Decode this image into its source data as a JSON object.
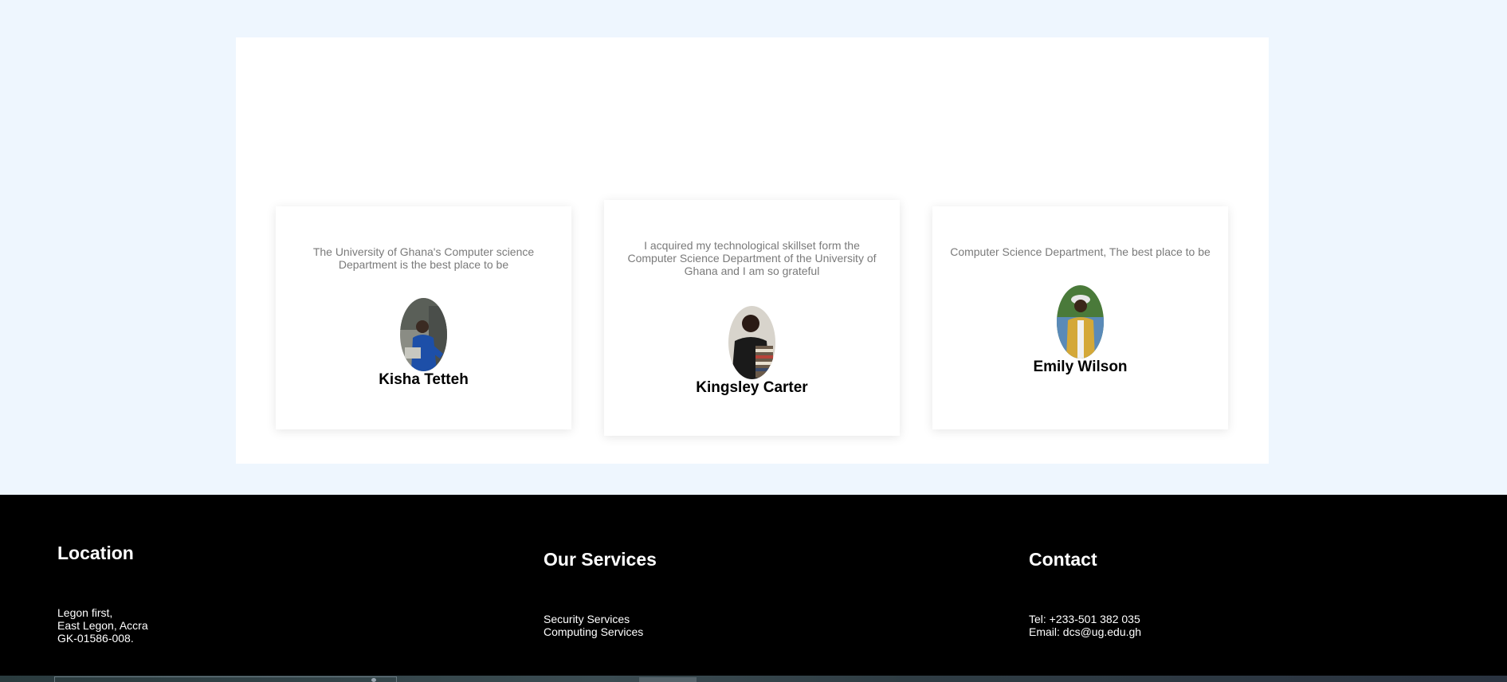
{
  "testimonials": [
    {
      "quote": "The University of Ghana's Computer science Department is the best place to be",
      "name": "Kisha Tetteh",
      "avatar_icon": "person-photo"
    },
    {
      "quote": "I acquired my technological skillset form the Computer Science Department of the University of Ghana and I am so grateful",
      "name": "Kingsley Carter",
      "avatar_icon": "person-photo"
    },
    {
      "quote": "Computer Science Department, The best place to be",
      "name": "Emily Wilson",
      "avatar_icon": "person-photo"
    }
  ],
  "footer": {
    "location": {
      "heading": "Location",
      "lines": [
        "Legon first,",
        "East Legon, Accra",
        "GK-01586-008."
      ]
    },
    "services": {
      "heading": "Our Services",
      "lines": [
        "Security Services",
        "Computing Services"
      ]
    },
    "contact": {
      "heading": "Contact",
      "lines": [
        "Tel: +233-501 382 035",
        "Email: dcs@ug.edu.gh"
      ]
    }
  },
  "colors": {
    "page_background": "#eef6fe",
    "panel_background": "#ffffff",
    "footer_background": "#000000",
    "quote_text": "#7a7a7a"
  }
}
